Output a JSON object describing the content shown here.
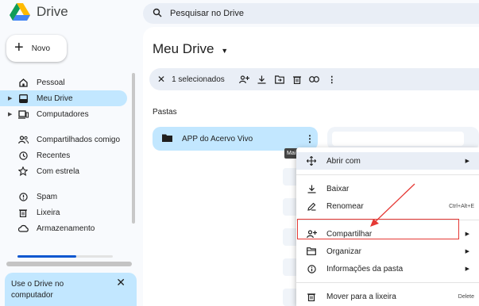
{
  "app": {
    "title": "Drive"
  },
  "search": {
    "placeholder": "Pesquisar no Drive"
  },
  "new_button": {
    "label": "Novo"
  },
  "sidebar": {
    "items": [
      {
        "label": "Pessoal",
        "icon": "home-icon"
      },
      {
        "label": "Meu Drive",
        "icon": "drive-icon",
        "active": true
      },
      {
        "label": "Computadores",
        "icon": "computer-icon"
      },
      {
        "label": "Compartilhados comigo",
        "icon": "people-icon"
      },
      {
        "label": "Recentes",
        "icon": "clock-icon"
      },
      {
        "label": "Com estrela",
        "icon": "star-icon"
      },
      {
        "label": "Spam",
        "icon": "spam-icon"
      },
      {
        "label": "Lixeira",
        "icon": "trash-icon"
      },
      {
        "label": "Armazenamento",
        "icon": "cloud-icon"
      }
    ],
    "storage_fraction": 0.62
  },
  "promo": {
    "text": "Use o Drive no computador"
  },
  "main": {
    "title": "Meu Drive",
    "toolbar": {
      "selected": "1 selecionados"
    },
    "section_title": "Pastas",
    "folder": {
      "name": "APP do Acervo Vivo"
    }
  },
  "tooltip": "Mai",
  "context_menu": {
    "items": [
      {
        "label": "Abrir com",
        "icon": "open-with-icon",
        "submenu": true
      },
      {
        "label": "Baixar",
        "icon": "download-icon"
      },
      {
        "label": "Renomear",
        "icon": "rename-icon",
        "shortcut": "Ctrl+Alt+E"
      },
      {
        "label": "Compartilhar",
        "icon": "share-icon",
        "submenu": true
      },
      {
        "label": "Organizar",
        "icon": "folder-icon",
        "submenu": true
      },
      {
        "label": "Informações da pasta",
        "icon": "info-icon",
        "submenu": true
      },
      {
        "label": "Mover para a lixeira",
        "icon": "trash-icon",
        "shortcut": "Delete"
      }
    ]
  },
  "colors": {
    "accent": "#c2e7ff",
    "highlight": "#e53935",
    "primary": "#0b57d0"
  }
}
